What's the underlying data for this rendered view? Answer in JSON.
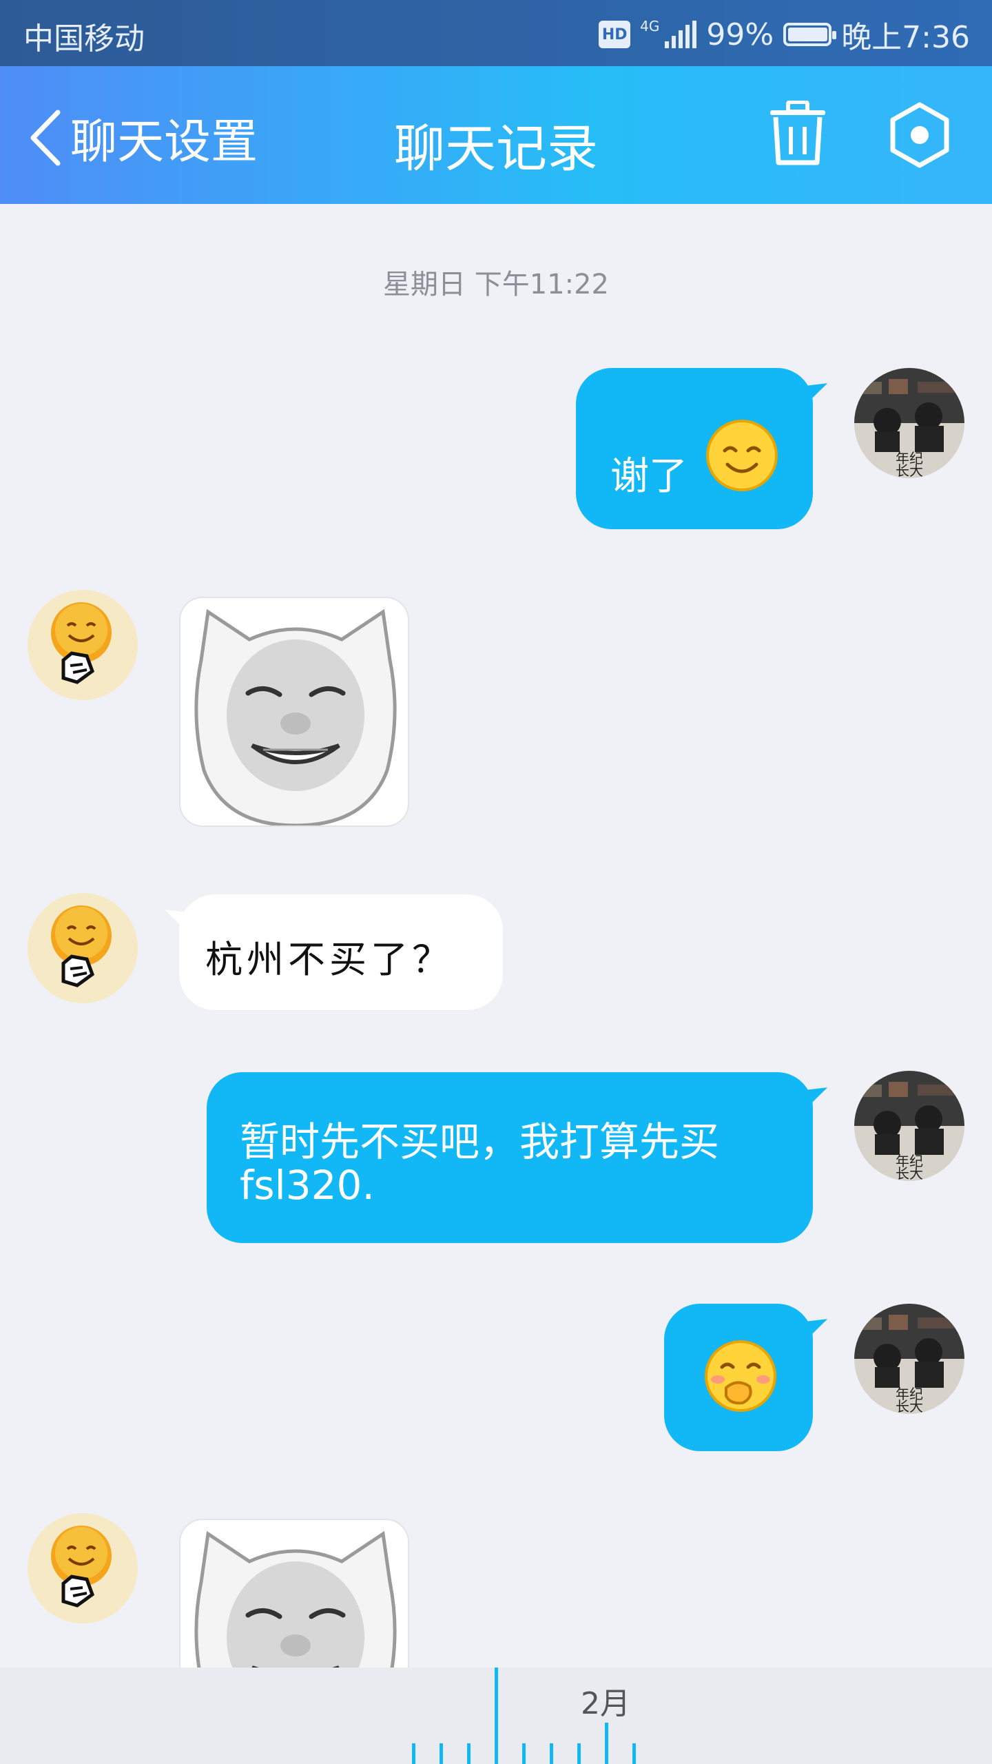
{
  "status_bar": {
    "carrier": "中国移动",
    "hd": "HD",
    "network": "4G",
    "battery": "99%",
    "time": "晚上7:36"
  },
  "nav": {
    "back_label": "聊天设置",
    "title": "聊天记录",
    "icons": [
      "chevron-left-icon",
      "trash-icon",
      "settings-icon"
    ]
  },
  "chat": {
    "timestamp": "星期日 下午11:22",
    "messages": [
      {
        "side": "out",
        "type": "text",
        "text": "谢了",
        "emoji": "smile"
      },
      {
        "side": "in",
        "type": "sticker",
        "sticker": "pig-face-grin"
      },
      {
        "side": "in",
        "type": "text",
        "text": "杭州不买了？"
      },
      {
        "side": "out",
        "type": "text",
        "text": "暂时先不买吧，我打算先买fsl320."
      },
      {
        "side": "out",
        "type": "emoji",
        "emoji": "cover-mouth"
      },
      {
        "side": "in",
        "type": "sticker",
        "sticker": "pig-face-grin"
      }
    ],
    "msg_thanks": "谢了",
    "msg_hangzhou": "杭州不买了？",
    "msg_plan_line1": "暂时先不买吧，我打算先买",
    "msg_plan_line2": "fsl320."
  },
  "timeline": {
    "month": "2月"
  },
  "colors": {
    "bubble_out": "#12b7f5",
    "bubble_in": "#ffffff",
    "background": "#eff1f7",
    "nav_gradient_start": "#4f8df7",
    "nav_gradient_end": "#27bdf7"
  }
}
